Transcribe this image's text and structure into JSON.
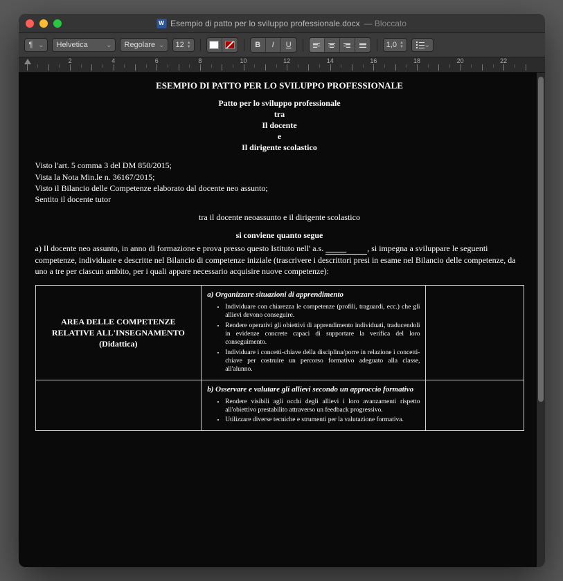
{
  "window": {
    "filename": "Esempio di patto per lo sviluppo professionale.docx",
    "status": "— Bloccato"
  },
  "toolbar": {
    "paragraph_style": "¶",
    "font_family": "Helvetica",
    "font_style": "Regolare",
    "font_size": "12",
    "line_spacing": "1,0"
  },
  "ruler": {
    "ticks": [
      2,
      4,
      6,
      8,
      10,
      12,
      14,
      16,
      18,
      20,
      22
    ]
  },
  "doc": {
    "title": "ESEMPIO DI PATTO PER LO SVILUPPO PROFESSIONALE",
    "subtitle": "Patto per lo sviluppo professionale",
    "tra": "tra",
    "party1": "Il docente",
    "e": "e",
    "party2": "Il dirigente scolastico",
    "refs": [
      "Visto l'art. 5 comma 3 del DM 850/2015;",
      "Vista la Nota Min.le n. 36167/2015;",
      "Visto il Bilancio delle Competenze elaborato dal docente neo assunto;",
      "Sentito il docente tutor"
    ],
    "between": "tra il docente neoassunto e il dirigente scolastico",
    "agree": "si conviene quanto segue",
    "clause_a_pre": "a) Il docente neo assunto, in anno di formazione e prova presso questo Istituto nell' a.s. ",
    "clause_a_post": ", si impegna a sviluppare le seguenti competenze, individuate e descritte nel Bilancio di competenze iniziale (trascrivere i descrittori presi in esame nel Bilancio delle competenze, da uno a tre per ciascun ambito, per i quali appare necessario acquisire nuove competenze):",
    "table": {
      "area1": "AREA DELLE COMPETENZE RELATIVE ALL'INSEGNAMENTO (Didattica)",
      "sec_a": {
        "heading": "a) Organizzare situazioni di apprendimento",
        "items": [
          "Individuare con chiarezza le competenze (profili, traguardi, ecc.) che gli allievi devono conseguire.",
          "Rendere operativi gli obiettivi di apprendimento individuati, traducendoli in evidenze concrete capaci di supportare la verifica del loro conseguimento.",
          "Individuare i concetti-chiave della disciplina/porre in relazione i concetti-chiave per costruire un percorso formativo adeguato alla classe, all'alunno."
        ]
      },
      "sec_b": {
        "heading": "b) Osservare e valutare gli allievi secondo un approccio formativo",
        "items": [
          "Rendere visibili agli occhi degli allievi i loro avanzamenti rispetto all'obiettivo prestabilito attraverso un feedback progressivo.",
          "Utilizzare diverse tecniche e strumenti per la valutazione formativa."
        ]
      }
    }
  }
}
